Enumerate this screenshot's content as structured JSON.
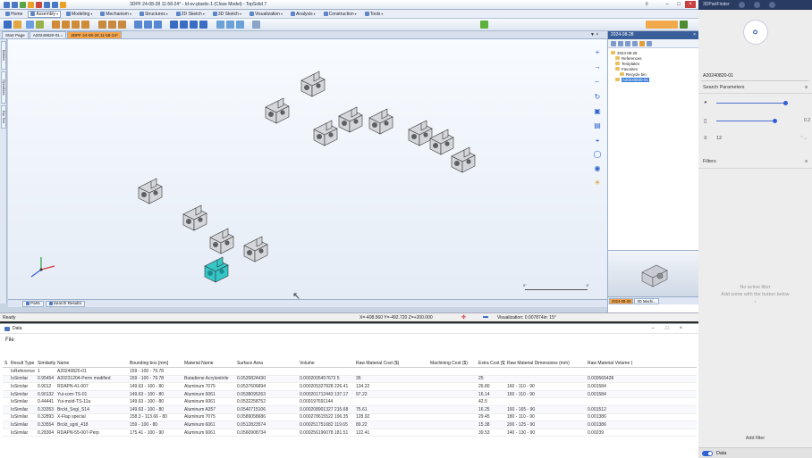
{
  "cad": {
    "title": "3DPF 24-08-28 11-58-24* - Id-ov-plastic-1 (Close Model) - TopSolid 7",
    "menu_tabs": [
      {
        "label": "Home"
      },
      {
        "label": "Assembly",
        "active": true
      },
      {
        "label": "Modeling"
      },
      {
        "label": "Mechanism"
      },
      {
        "label": "Structures"
      },
      {
        "label": "2D Sketch"
      },
      {
        "label": "3D Sketch"
      },
      {
        "label": "Visualization"
      },
      {
        "label": "Analysis"
      },
      {
        "label": "Construction"
      },
      {
        "label": "Tools"
      }
    ],
    "doc_tabs": [
      {
        "label": "Start Page"
      },
      {
        "label": "A20240820-01"
      },
      {
        "label": "3DPF 24-08-28 11-58-24*",
        "active": true
      }
    ],
    "left_tabs": [
      "Entities",
      "Operations",
      "Exp Tree"
    ],
    "bottom_tabs": [
      "Parts",
      "Search Results"
    ],
    "status": {
      "ready": "Ready",
      "coords": "X=-408.560  Y=-492.720  Z=+200.000",
      "visualization": "Visualization: 0.007874in: 15°"
    },
    "scale_labels": [
      "0\"",
      "4\""
    ],
    "right_panel": {
      "title": "2024-08-28",
      "tree": [
        {
          "label": "2024-08-28",
          "indent": 0
        },
        {
          "label": "References",
          "indent": 1
        },
        {
          "label": "Templates",
          "indent": 1
        },
        {
          "label": "Favorites",
          "indent": 1
        },
        {
          "label": "Recycle bin",
          "indent": 2
        },
        {
          "label": "A20240820-01",
          "indent": 1,
          "selected": true
        }
      ],
      "tabs": [
        "2024-08-28",
        "3D Machi..."
      ]
    }
  },
  "data_window": {
    "title": "Data",
    "menu": "File",
    "columns": [
      "S",
      "Result Type",
      "Similarity",
      "Name",
      "Bounding box [mm]",
      "Material Name",
      "Surface Area",
      "Volume",
      "Raw Material Cost ($)",
      "Machining Cost ($)",
      "Extra Cost ($)",
      "Raw Material Dimensions (mm)",
      "Raw Material Volume ("
    ],
    "rows": [
      [
        "",
        "IsReference",
        "1",
        "A20240820-01",
        "159 - 100 - 79.78",
        "",
        "",
        "",
        "",
        "",
        "",
        "",
        ""
      ],
      [
        "",
        "IsSimilar",
        "0.95454",
        "A20231204-Perm modified",
        "159 - 100 - 79.78",
        "Butadiene Acrylonitrile",
        "0.0535824430",
        "0.0002005457673 5",
        "35",
        "",
        "25",
        "",
        "0.000565428"
      ],
      [
        "",
        "IsSimilar",
        "0.9012",
        "RDAPN-41-007",
        "149.63 - 100 - 80",
        "Aluminum 7075",
        "0.0537606894",
        "0.000205327828 226.41",
        "134.22",
        "",
        "26.80",
        "160 - 110 - 90",
        "0.001584"
      ],
      [
        "",
        "IsSimilar",
        "0.90132",
        "Yui-com-TS-01",
        "149.63 - 100 - 80",
        "Aluminum 6061",
        "0.0538095263",
        "0.000201712443 137.17",
        "97.22",
        "",
        "16.14",
        "160 - 110 - 90",
        "0.001584"
      ],
      [
        "",
        "IsSimilar",
        "0.44441",
        "Yui-mold-TS-11a",
        "149.63 - 100 - 80",
        "Aluminum 6061",
        "0.0532258752",
        "0.000197691144",
        "",
        "",
        "42.5",
        "",
        ""
      ],
      [
        "",
        "IsSimilar",
        "0.33353",
        "Brckt_Sngl_S14",
        "149.63 - 100 - 80",
        "Aluminum A357",
        "0.0540715106",
        "0.000208901327 215.68",
        "75.61",
        "",
        "16.25",
        "160 - 165 - 90",
        "0.001512"
      ],
      [
        "",
        "IsSimilar",
        "0.32893",
        "X-Flap special",
        "158.3 - 113.66 - 80",
        "Aluminum 7075",
        "0.0589058686",
        "0.000278615522 196.35",
        "128.92",
        "",
        "29.45",
        "180 - 110 - 90",
        "0.001386"
      ],
      [
        "",
        "IsSimilar",
        "0.33554",
        "Brckt_sgnl_418",
        "159 - 100 - 80",
        "Aluminum 6061",
        "0.0512823574",
        "0.000251751682 119.65",
        "89.22",
        "",
        "15.38",
        "200 - 125 - 90",
        "0.001386"
      ],
      [
        "",
        "IsSimilar",
        "0.28304",
        "RDAPN-55-007-Perp",
        "175.41 - 100 - 90",
        "Aluminum 6061",
        "0.0560908734",
        "0.000256196078 181.51",
        "122.41",
        "",
        "39.53",
        "140 - 130 - 90",
        "0.00239"
      ]
    ]
  },
  "sidebar": {
    "app_title": "3DPartFinder",
    "part_name": "A20240820-01",
    "search_params": "Search Parameters",
    "slider2_value": "0.2",
    "count_value": "12",
    "filters": "Filters",
    "empty_line1": "No active filter",
    "empty_line2": "Add some with the button below",
    "add_filter": "Add filter",
    "data_toggle": "Data"
  }
}
